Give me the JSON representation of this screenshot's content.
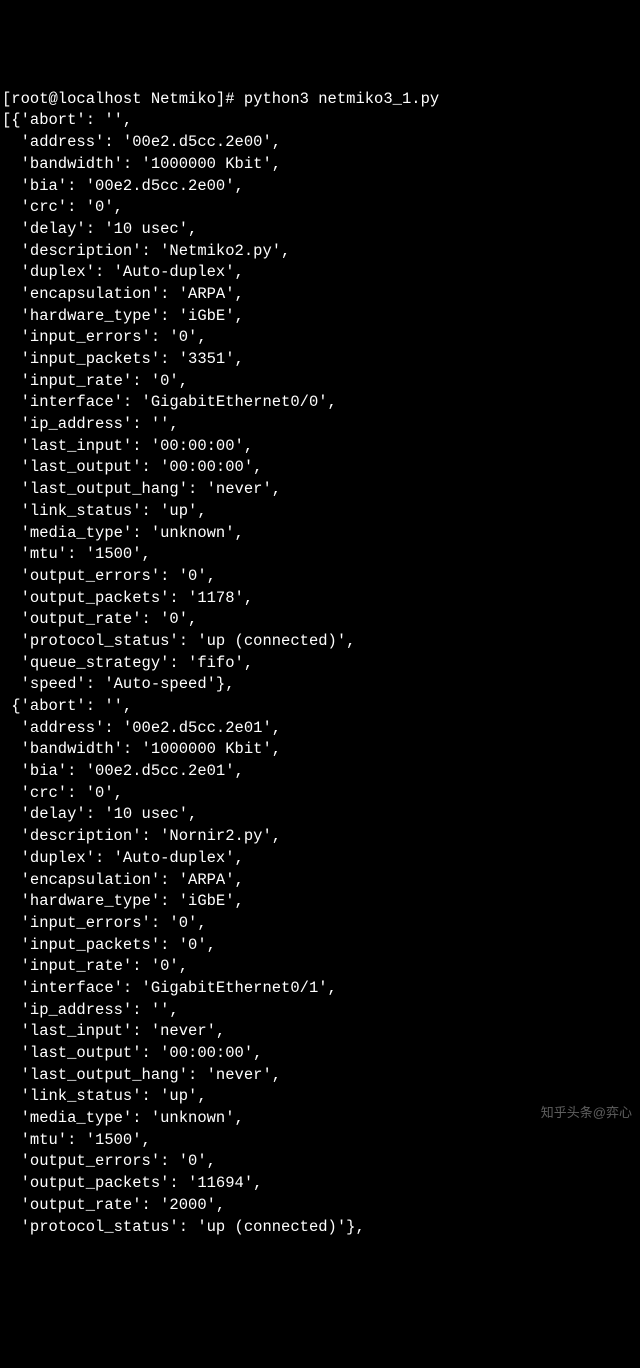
{
  "prompt": "[root@localhost Netmiko]# python3 netmiko3_1.py",
  "entries": [
    {
      "abort": "",
      "address": "00e2.d5cc.2e00",
      "bandwidth": "1000000 Kbit",
      "bia": "00e2.d5cc.2e00",
      "crc": "0",
      "delay": "10 usec",
      "description": "Netmiko2.py",
      "duplex": "Auto-duplex",
      "encapsulation": "ARPA",
      "hardware_type": "iGbE",
      "input_errors": "0",
      "input_packets": "3351",
      "input_rate": "0",
      "interface": "GigabitEthernet0/0",
      "ip_address": "",
      "last_input": "00:00:00",
      "last_output": "00:00:00",
      "last_output_hang": "never",
      "link_status": "up",
      "media_type": "unknown",
      "mtu": "1500",
      "output_errors": "0",
      "output_packets": "1178",
      "output_rate": "0",
      "protocol_status": "up (connected)",
      "queue_strategy": "fifo",
      "speed": "Auto-speed"
    },
    {
      "abort": "",
      "address": "00e2.d5cc.2e01",
      "bandwidth": "1000000 Kbit",
      "bia": "00e2.d5cc.2e01",
      "crc": "0",
      "delay": "10 usec",
      "description": "Nornir2.py",
      "duplex": "Auto-duplex",
      "encapsulation": "ARPA",
      "hardware_type": "iGbE",
      "input_errors": "0",
      "input_packets": "0",
      "input_rate": "0",
      "interface": "GigabitEthernet0/1",
      "ip_address": "",
      "last_input": "never",
      "last_output": "00:00:00",
      "last_output_hang": "never",
      "link_status": "up",
      "media_type": "unknown",
      "mtu": "1500",
      "output_errors": "0",
      "output_packets": "11694",
      "output_rate": "2000",
      "protocol_status": "up (connected)"
    }
  ],
  "keys_order": [
    "abort",
    "address",
    "bandwidth",
    "bia",
    "crc",
    "delay",
    "description",
    "duplex",
    "encapsulation",
    "hardware_type",
    "input_errors",
    "input_packets",
    "input_rate",
    "interface",
    "ip_address",
    "last_input",
    "last_output",
    "last_output_hang",
    "link_status",
    "media_type",
    "mtu",
    "output_errors",
    "output_packets",
    "output_rate",
    "protocol_status",
    "queue_strategy",
    "speed"
  ],
  "watermark": "知乎头条@弈心"
}
